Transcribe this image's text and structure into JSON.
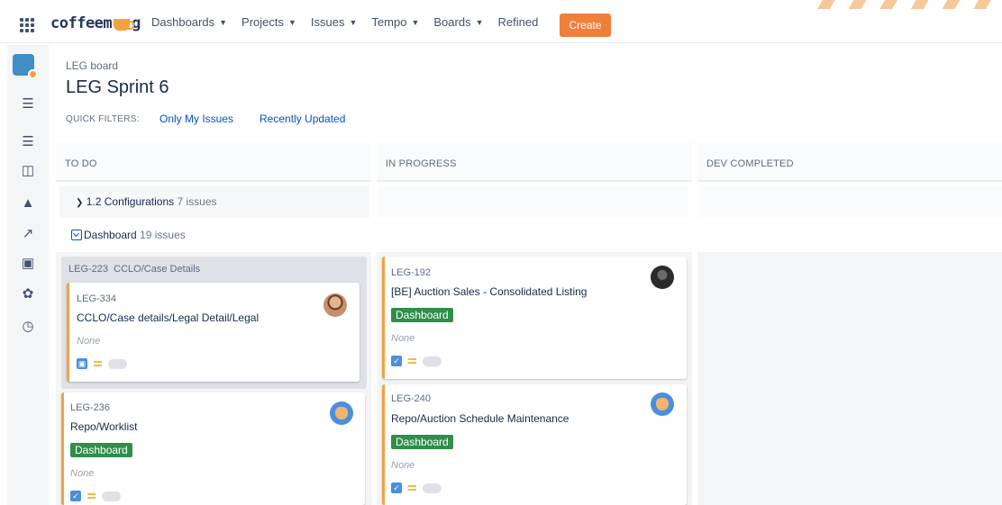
{
  "nav": {
    "logo_prefix": "coffeem",
    "logo_suffix": "g",
    "items": [
      {
        "label": "Dashboards",
        "has_menu": true
      },
      {
        "label": "Projects",
        "has_menu": true
      },
      {
        "label": "Issues",
        "has_menu": true
      },
      {
        "label": "Tempo",
        "has_menu": true
      },
      {
        "label": "Boards",
        "has_menu": true
      },
      {
        "label": "Refined",
        "has_menu": false
      }
    ],
    "create_label": "Create",
    "accent_color": "#f07f3c"
  },
  "sidebar": {
    "icons": [
      "app-switcher-icon",
      "project-avatar-icon",
      "backlog-icon",
      "releases-icon",
      "board-icon",
      "shipping-icon",
      "reports-icon",
      "issues-icon",
      "components-icon",
      "history-icon"
    ]
  },
  "header": {
    "breadcrumb": "LEG board",
    "title": "LEG Sprint 6",
    "quick_filters_label": "QUICK FILTERS:",
    "quick_filters": [
      "Only My Issues",
      "Recently Updated"
    ]
  },
  "columns": [
    "TO DO",
    "IN PROGRESS",
    "DEV COMPLETED"
  ],
  "swimlanes": [
    {
      "name": "1.2 Configurations",
      "count": "7 issues",
      "collapsed": true
    },
    {
      "name": "Dashboard",
      "count": "19 issues",
      "collapsed": false
    }
  ],
  "parent": {
    "key": "LEG-223",
    "summary": "CCLO/Case Details"
  },
  "cards": {
    "leg334": {
      "key": "LEG-334",
      "summary": "CCLO/Case details/Legal Detail/Legal",
      "fix": "None"
    },
    "leg236": {
      "key": "LEG-236",
      "summary": "Repo/Worklist",
      "epic": "Dashboard",
      "fix": "None"
    },
    "leg192": {
      "key": "LEG-192",
      "summary": "[BE] Auction Sales - Consolidated Listing",
      "epic": "Dashboard",
      "fix": "None"
    },
    "leg240": {
      "key": "LEG-240",
      "summary": "Repo/Auction Schedule Maintenance",
      "epic": "Dashboard",
      "fix": "None"
    }
  }
}
